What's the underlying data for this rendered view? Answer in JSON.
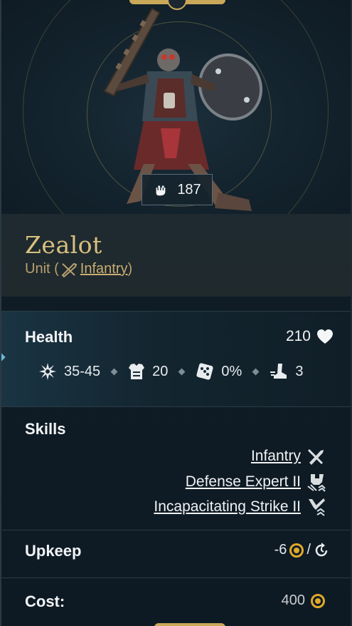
{
  "unit": {
    "name": "Zealot",
    "type_prefix": "Unit (",
    "type_link": "Infantry",
    "type_suffix": ")",
    "power": "187"
  },
  "health": {
    "label": "Health",
    "value": "210"
  },
  "stats": {
    "damage": "35-45",
    "armor": "20",
    "chance": "0%",
    "movement": "3"
  },
  "skills": {
    "label": "Skills",
    "items": [
      "Infantry",
      "Defense Expert II",
      "Incapacitating Strike II"
    ]
  },
  "upkeep": {
    "label": "Upkeep",
    "value": "-6",
    "slash": "/"
  },
  "cost": {
    "label": "Cost:",
    "value": "400"
  },
  "colors": {
    "gold": "#d9c07e",
    "accent": "#e0a92a",
    "panel": "#0f1c26"
  }
}
